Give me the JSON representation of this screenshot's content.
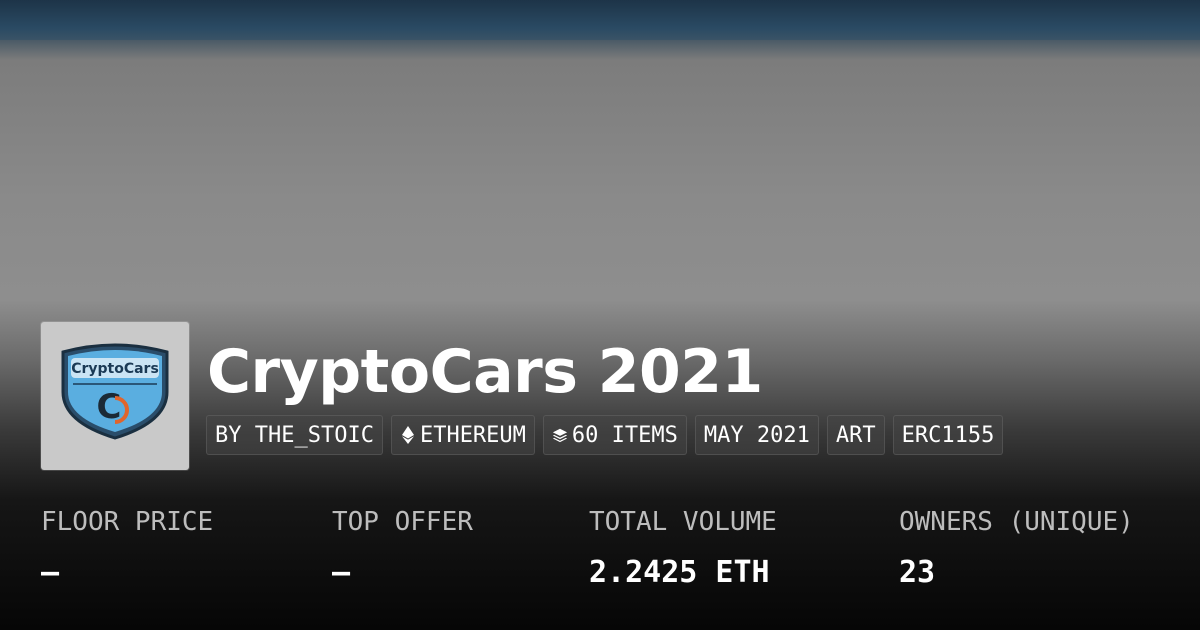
{
  "collection": {
    "title": "CryptoCars 2021",
    "logo_text": "CryptoCars",
    "logo_monogram": "C"
  },
  "tags": [
    {
      "label": "BY THE_STOIC",
      "icon": ""
    },
    {
      "label": "ETHEREUM",
      "icon": "ethereum-icon"
    },
    {
      "label": "60 ITEMS",
      "icon": "layers-icon"
    },
    {
      "label": "MAY 2021",
      "icon": ""
    },
    {
      "label": "ART",
      "icon": ""
    },
    {
      "label": "ERC1155",
      "icon": ""
    }
  ],
  "stats": [
    {
      "label": "FLOOR PRICE",
      "value": "—"
    },
    {
      "label": "TOP OFFER",
      "value": "—"
    },
    {
      "label": "TOTAL VOLUME",
      "value": "2.2425 ETH"
    },
    {
      "label": "OWNERS (UNIQUE)",
      "value": "23"
    }
  ],
  "colors": {
    "banner_top": "#27455e",
    "banner_mid": "#8a8a8a",
    "text": "#ffffff",
    "stat_label": "#bdbdbd",
    "logo_shield": "#4da3d8",
    "logo_accent": "#e0652c"
  }
}
